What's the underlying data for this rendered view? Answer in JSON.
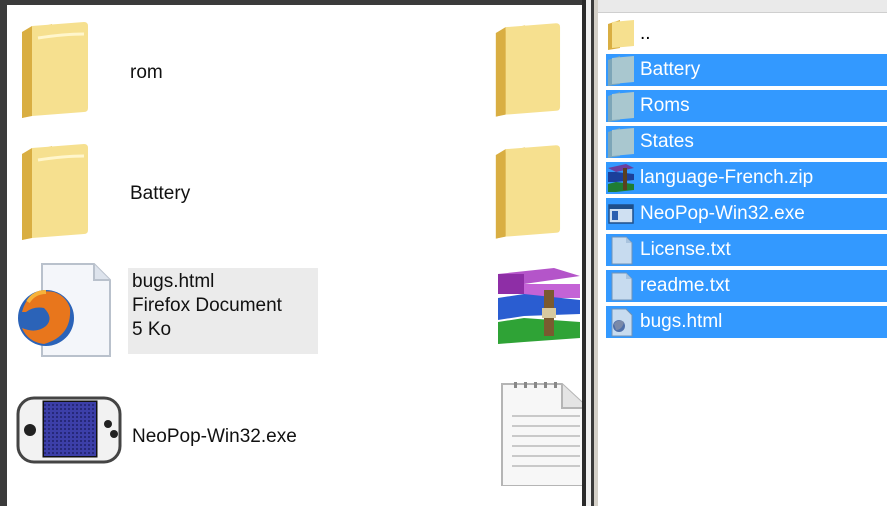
{
  "left_pane": {
    "items": [
      {
        "label": "rom",
        "icon": "folder-icon"
      },
      {
        "label": "Battery",
        "icon": "folder-icon"
      },
      {
        "label": "bugs.html",
        "type": "Firefox Document",
        "size": "5 Ko",
        "icon": "firefox-document-icon"
      },
      {
        "label": "NeoPop-Win32.exe",
        "icon": "neogeo-pocket-icon"
      }
    ],
    "partial_icons": [
      "folder-icon",
      "folder-icon",
      "winrar-archive-icon",
      "text-document-icon"
    ]
  },
  "right_pane": {
    "items": [
      {
        "label": "..",
        "icon": "folder-up-icon",
        "selected": false
      },
      {
        "label": "Battery",
        "icon": "folder-icon",
        "selected": true
      },
      {
        "label": "Roms",
        "icon": "folder-icon",
        "selected": true
      },
      {
        "label": "States",
        "icon": "folder-icon",
        "selected": true
      },
      {
        "label": "language-French.zip",
        "icon": "winrar-archive-icon",
        "selected": true
      },
      {
        "label": "NeoPop-Win32.exe",
        "icon": "exe-window-icon",
        "selected": true
      },
      {
        "label": "License.txt",
        "icon": "text-file-icon",
        "selected": true
      },
      {
        "label": "readme.txt",
        "icon": "text-file-icon",
        "selected": true
      },
      {
        "label": "bugs.html",
        "icon": "html-file-icon",
        "selected": true
      }
    ]
  },
  "colors": {
    "selection": "#3399ff",
    "folder": "#f3d983",
    "border": "#3b3b3b"
  }
}
